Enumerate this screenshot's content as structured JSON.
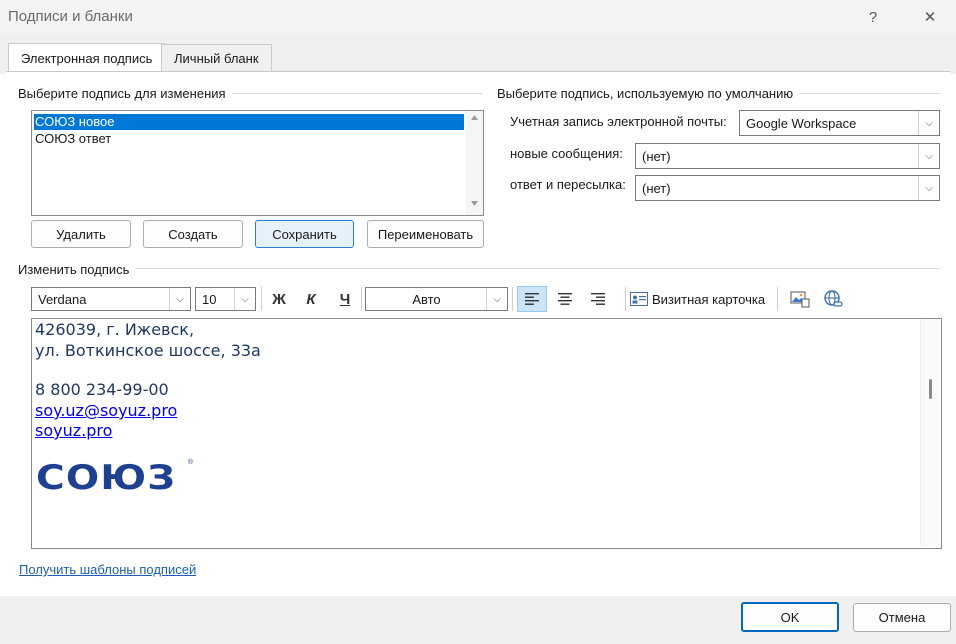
{
  "window": {
    "title": "Подписи и бланки",
    "help": "?",
    "close": "✕"
  },
  "tabs": [
    {
      "label": "Электронная подпись",
      "active": true
    },
    {
      "label": "Личный бланк",
      "active": false
    }
  ],
  "select_signature": {
    "label": "Выберите подпись для изменения",
    "items": [
      "СОЮЗ новое",
      "СОЮЗ ответ"
    ],
    "selected": "СОЮЗ новое",
    "buttons": {
      "delete": "Удалить",
      "create": "Создать",
      "save": "Сохранить",
      "rename": "Переименовать"
    }
  },
  "default_signature": {
    "label": "Выберите подпись, используемую по умолчанию",
    "account_label": "Учетная запись электронной почты:",
    "account_value": "Google Workspace",
    "new_messages_label": "новые сообщения:",
    "new_messages_value": "(нет)",
    "reply_label": "ответ и пересылка:",
    "reply_value": "(нет)"
  },
  "edit_signature": {
    "label": "Изменить подпись",
    "font": "Verdana",
    "size": "10",
    "bold": "Ж",
    "italic": "К",
    "underline": "Ч",
    "color": "Авто",
    "business_card": "Визитная карточка",
    "content": {
      "line1": "426039, г. Ижевск,",
      "line2": "ул. Воткинское шоссе, 33а",
      "phone": "8 800 234-99-00",
      "email": "soy.uz@soyuz.pro",
      "site": "soyuz.pro",
      "logo_text": "СОЮЗ",
      "logo_color": "#1f3f8f"
    }
  },
  "templates_link": "Получить шаблоны подписей",
  "footer": {
    "ok": "OK",
    "cancel": "Отмена"
  },
  "colors": {
    "accent": "#0078d7",
    "link": "#0000ee",
    "sig_text": "#1f3864"
  }
}
